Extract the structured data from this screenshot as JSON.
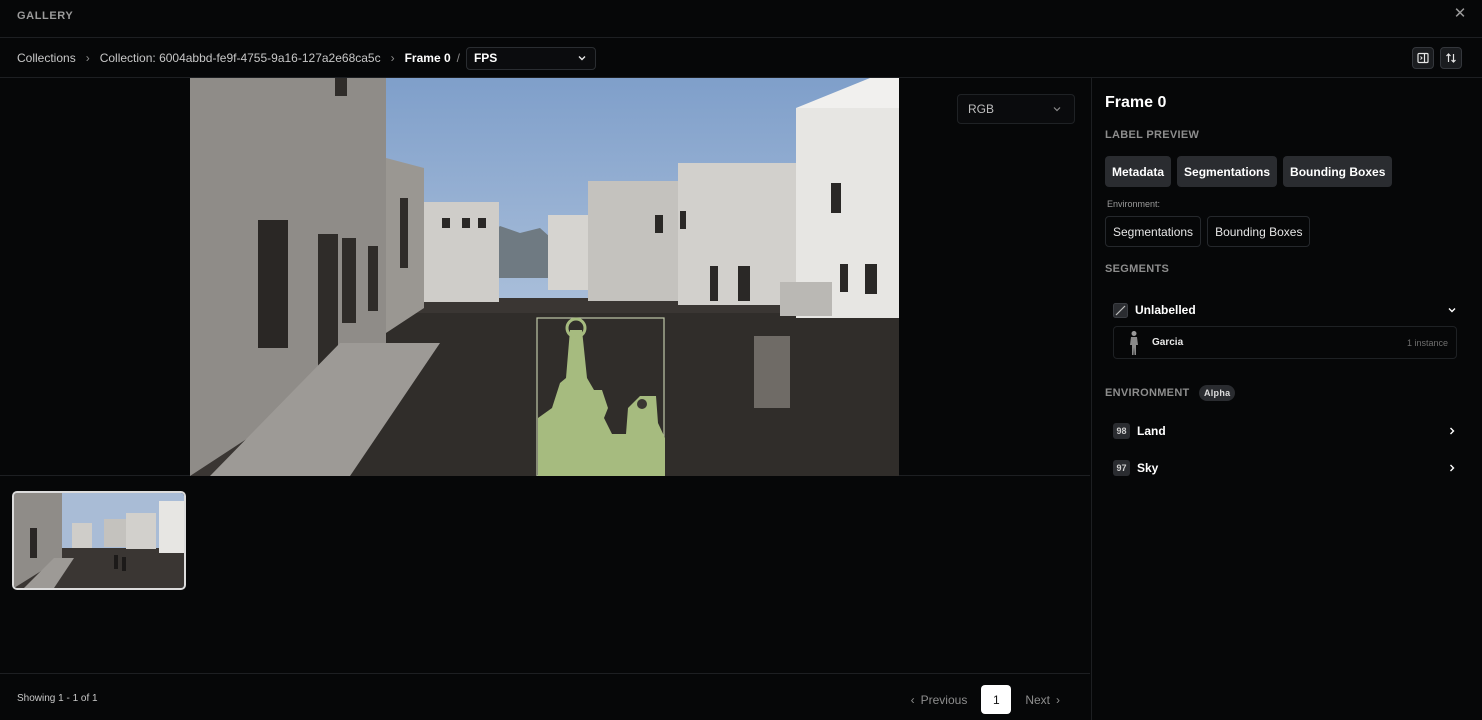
{
  "window": {
    "title": "GALLERY"
  },
  "breadcrumb": {
    "collections": "Collections",
    "collection": "Collection: 6004abbd-fe9f-4755-9a16-127a2e68ca5c",
    "frame": "Frame 0",
    "slash": "/",
    "view_select": "FPS"
  },
  "viewer": {
    "channel_select": "RGB"
  },
  "footer": {
    "showing": "Showing 1 - 1 of 1",
    "previous": "Previous",
    "page": "1",
    "next": "Next"
  },
  "panel": {
    "frame_title": "Frame 0",
    "label_preview": "LABEL PREVIEW",
    "chips": [
      "Metadata",
      "Segmentations",
      "Bounding Boxes"
    ],
    "environment_label": "Environment:",
    "env_chips": [
      "Segmentations",
      "Bounding Boxes"
    ],
    "segments_label": "SEGMENTS",
    "segment_group": "Unlabelled",
    "instance_name": "Garcia",
    "instance_count": "1 instance",
    "environment_title": "ENVIRONMENT",
    "environment_badge": "Alpha",
    "environment_items": [
      {
        "id": "98",
        "name": "Land"
      },
      {
        "id": "97",
        "name": "Sky"
      }
    ]
  },
  "colors": {
    "background": "#060708",
    "segmentation_overlay": "#a6bb7f",
    "sky": "#9cb6d8",
    "ground": "#3a3633",
    "building_light": "#d8d6d2"
  },
  "icons": [
    "close-icon",
    "chevron-right-icon",
    "chevron-down-icon",
    "panel-toggle-icon",
    "sort-icon",
    "slash-icon",
    "person-icon"
  ]
}
